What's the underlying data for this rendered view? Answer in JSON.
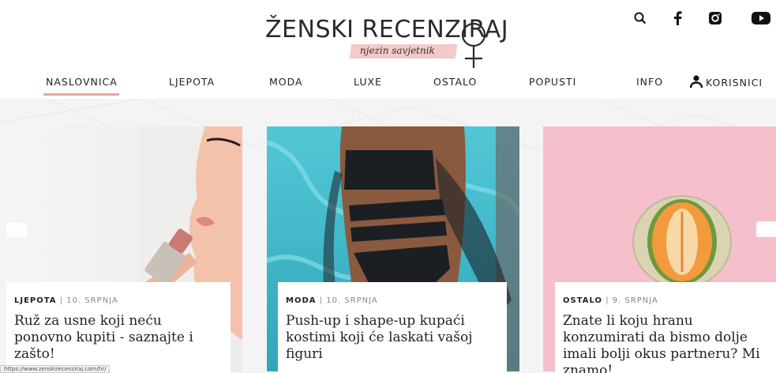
{
  "logo": {
    "name": "ŽENSKI RECENZIRAJ",
    "tagline": "njezin savjetnik"
  },
  "social": [
    "search-icon",
    "facebook-icon",
    "instagram-icon",
    "youtube-icon"
  ],
  "nav": {
    "items": [
      "NASLOVNICA",
      "LJEPOTA",
      "MODA",
      "LUXE",
      "OSTALO",
      "POPUSTI",
      "INFO",
      "KORISNICI"
    ],
    "active": "NASLOVNICA",
    "accent": "#e4a9a0"
  },
  "cards": [
    {
      "category": "LJEPOTA",
      "date": "10. SRPNJA",
      "title": "Ruž za usne koji neću ponovno kupiti - saznajte i zašto!"
    },
    {
      "category": "MODA",
      "date": "10. SRPNJA",
      "title": "Push-up i shape-up kupaći kostimi koji će laskati vašoj figuri"
    },
    {
      "category": "OSTALO",
      "date": "9. SRPNJA",
      "title": "Znate li koju hranu konzumirati da bismo dolje imali bolji okus partneru? Mi znamo!"
    }
  ],
  "status_url": "https://www.zenskirecenziraj.com/hr/"
}
